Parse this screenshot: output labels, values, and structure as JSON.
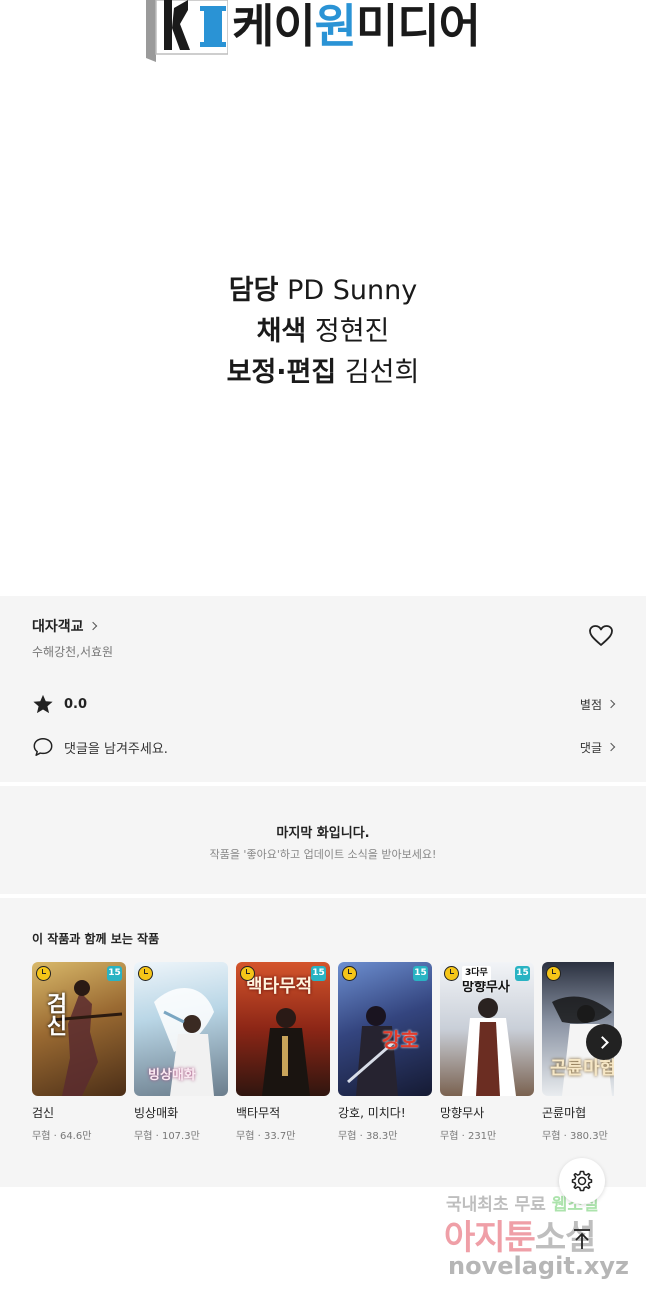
{
  "header": {
    "logo_prefix": "케이",
    "logo_accent": "원",
    "logo_suffix": "미디어"
  },
  "credits": [
    {
      "role": "담당",
      "name": "PD Sunny"
    },
    {
      "role": "채색",
      "name": "정현진"
    },
    {
      "role": "보정·편집",
      "name": "김선희"
    }
  ],
  "work": {
    "title": "대자객교",
    "authors": "수해강천,서효원",
    "rating": "0.0",
    "rating_link": "별점",
    "comment_prompt": "댓글을 남겨주세요.",
    "comment_link": "댓글"
  },
  "last_episode": {
    "title": "마지막 화입니다.",
    "subtitle": "작품을 '좋아요'하고 업데이트 소식을 받아보세요!"
  },
  "recommendations": {
    "heading": "이 작품과 함께 보는 작품",
    "items": [
      {
        "title": "검신",
        "genre": "무협",
        "views": "64.6만",
        "age": "15",
        "cover_text": "검신",
        "colors": [
          "#c7a55a",
          "#5a3b1c"
        ]
      },
      {
        "title": "빙상매화",
        "genre": "무협",
        "views": "107.3만",
        "age": "",
        "cover_text": "빙상매화",
        "colors": [
          "#b9d6e6",
          "#6b7d8c"
        ]
      },
      {
        "title": "백타무적",
        "genre": "무협",
        "views": "33.7만",
        "age": "15",
        "cover_text": "백타무적",
        "colors": [
          "#b2341f",
          "#3a1a12"
        ]
      },
      {
        "title": "강호, 미치다!",
        "genre": "무협",
        "views": "38.3만",
        "age": "15",
        "cover_text": "강호",
        "colors": [
          "#4a6fb5",
          "#1b2346"
        ]
      },
      {
        "title": "망향무사",
        "genre": "무협",
        "views": "231만",
        "age": "15",
        "tag": "3다무",
        "cover_text": "망향무사",
        "colors": [
          "#dfe3ea",
          "#8e6e5a"
        ]
      },
      {
        "title": "곤륜마협",
        "genre": "무협",
        "views": "380.3만",
        "age": "",
        "cover_text": "곤륜마협",
        "colors": [
          "#e9ecef",
          "#2b3140"
        ]
      }
    ]
  },
  "watermark": {
    "line1_a": "국내최초 무료 ",
    "line1_b": "웹소설",
    "line2_a": "아지툰",
    "line2_b": "소설",
    "line3": "novelagit.xyz"
  },
  "colors": {
    "accent": "#2a93d5",
    "panel_bg": "#f5f5f5",
    "age_badge": "#29b3c3",
    "clock_badge": "#f5c518"
  },
  "icons": {
    "heart": "heart-icon",
    "star": "star-icon",
    "comment": "speech-bubble-icon",
    "next": "chevron-right-icon",
    "settings": "gear-icon",
    "top": "arrow-up-icon"
  }
}
